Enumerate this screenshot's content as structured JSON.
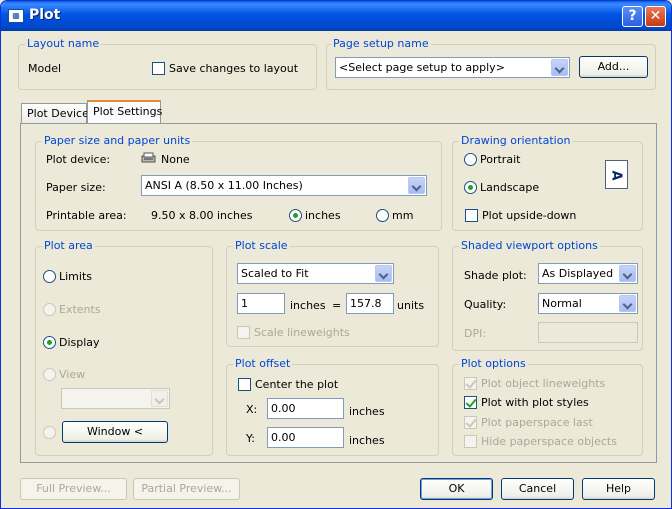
{
  "window": {
    "title": "Plot",
    "help": "?",
    "close": "✕"
  },
  "layout_name": {
    "title": "Layout name",
    "value": "Model",
    "save_label": "Save changes to layout"
  },
  "page_setup": {
    "title": "Page setup name",
    "selected": "<Select page setup to apply>",
    "add_label": "Add..."
  },
  "tabs": [
    {
      "label": "Plot Device"
    },
    {
      "label": "Plot Settings"
    }
  ],
  "paper": {
    "title": "Paper size and paper units",
    "device_label": "Plot device:",
    "device_value": "None",
    "size_label": "Paper size:",
    "size_value": "ANSI A (8.50 x 11.00 Inches)",
    "printable_label": "Printable area:",
    "printable_value": "9.50 x 8.00 inches",
    "unit_inches": "inches",
    "unit_mm": "mm"
  },
  "orientation": {
    "title": "Drawing orientation",
    "portrait": "Portrait",
    "landscape": "Landscape",
    "upside_down": "Plot upside-down",
    "preview_glyph": "A"
  },
  "plot_area": {
    "title": "Plot area",
    "limits": "Limits",
    "extents": "Extents",
    "display": "Display",
    "view": "View",
    "window_btn": "Window <"
  },
  "plot_scale": {
    "title": "Plot scale",
    "selected": "Scaled to Fit",
    "value1": "1",
    "unit1": "inches",
    "equals": "=",
    "value2": "157.8",
    "unit2": "units",
    "scale_lineweights": "Scale lineweights"
  },
  "plot_offset": {
    "title": "Plot offset",
    "center": "Center the plot",
    "x_label": "X:",
    "x_value": "0.00",
    "x_unit": "inches",
    "y_label": "Y:",
    "y_value": "0.00",
    "y_unit": "inches"
  },
  "shaded": {
    "title": "Shaded viewport options",
    "shade_label": "Shade plot:",
    "shade_value": "As Displayed",
    "quality_label": "Quality:",
    "quality_value": "Normal",
    "dpi_label": "DPI:"
  },
  "plot_options": {
    "title": "Plot options",
    "lineweights": "Plot object lineweights",
    "styles": "Plot with plot styles",
    "paperspace_last": "Plot paperspace last",
    "hide_objects": "Hide paperspace objects"
  },
  "footer": {
    "full_preview": "Full Preview...",
    "partial_preview": "Partial Preview...",
    "ok": "OK",
    "cancel": "Cancel",
    "help": "Help"
  },
  "colors": {
    "group_title": "#0046d5",
    "titlebar": "#0054e3",
    "check": "#21a121"
  }
}
